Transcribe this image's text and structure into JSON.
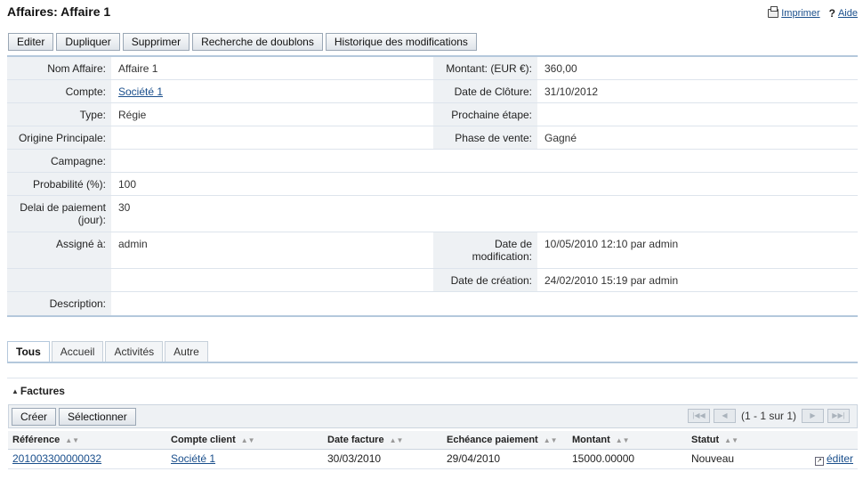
{
  "header": {
    "title": "Affaires: Affaire 1",
    "print_label": "Imprimer",
    "help_label": "Aide",
    "help_glyph": "?"
  },
  "actions": [
    "Editer",
    "Dupliquer",
    "Supprimer",
    "Recherche de doublons",
    "Historique des modifications"
  ],
  "detail": {
    "name_label": "Nom Affaire:",
    "name_value": "Affaire 1",
    "amount_label": "Montant: (EUR €):",
    "amount_value": "360,00",
    "account_label": "Compte:",
    "account_value": "Société 1",
    "close_label": "Date de Clôture:",
    "close_value": "31/10/2012",
    "type_label": "Type:",
    "type_value": "Régie",
    "next_label": "Prochaine étape:",
    "next_value": "",
    "origin_label": "Origine Principale:",
    "origin_value": "",
    "phase_label": "Phase de vente:",
    "phase_value": "Gagné",
    "campaign_label": "Campagne:",
    "campaign_value": "",
    "prob_label": "Probabilité (%):",
    "prob_value": "100",
    "delay_label": "Delai de paiement (jour):",
    "delay_value": "30",
    "assigned_label": "Assigné à:",
    "assigned_value": "admin",
    "modified_label": "Date de modification:",
    "modified_value": "10/05/2010 12:10 par admin",
    "created_label": "Date de création:",
    "created_value": "24/02/2010 15:19 par admin",
    "desc_label": "Description:",
    "desc_value": ""
  },
  "tabs": [
    "Tous",
    "Accueil",
    "Activités",
    "Autre"
  ],
  "invoices": {
    "title": "Factures",
    "create_label": "Créer",
    "select_label": "Sélectionner",
    "pager_text": "(1 - 1 sur 1)",
    "columns": [
      "Référence",
      "Compte client",
      "Date facture",
      "Echéance paiement",
      "Montant",
      "Statut"
    ],
    "rows": [
      {
        "reference": "201003300000032",
        "account": "Société 1",
        "date": "30/03/2010",
        "due": "29/04/2010",
        "amount": "15000.00000",
        "status": "Nouveau",
        "edit": "éditer"
      }
    ]
  },
  "icons": {
    "print": "printer-icon",
    "sort": "sort-icon",
    "edit": "edit-icon",
    "collapse": "collapse-icon",
    "first": "first-page-icon",
    "prev": "prev-page-icon",
    "next": "next-page-icon",
    "last": "last-page-icon"
  }
}
